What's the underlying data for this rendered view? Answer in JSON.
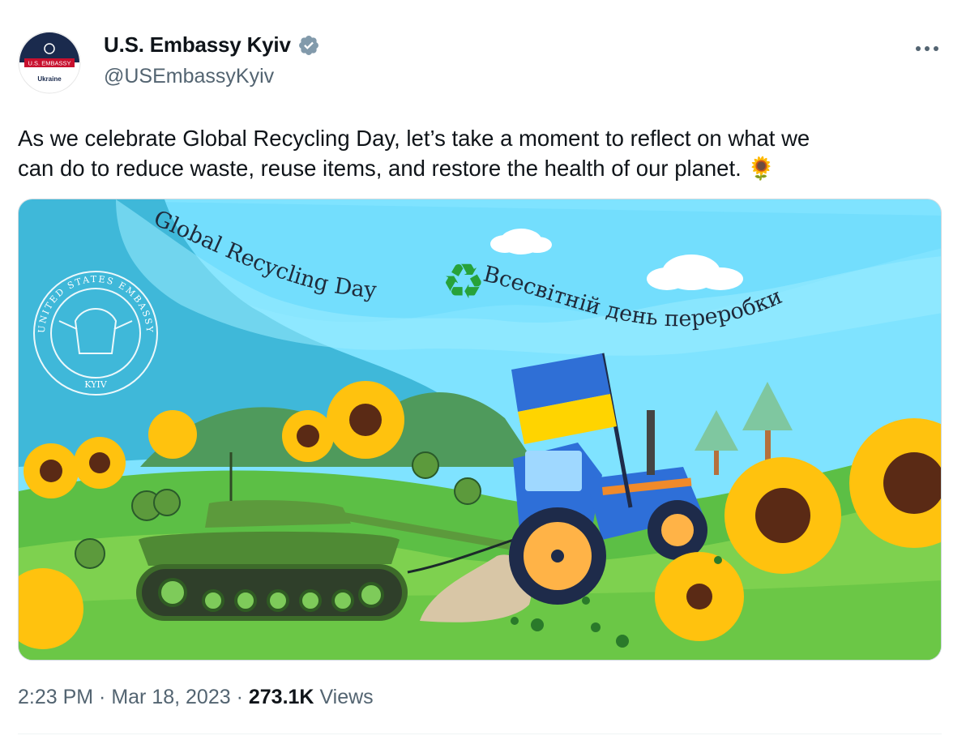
{
  "account": {
    "display_name": "U.S. Embassy Kyiv",
    "handle": "@USEmbassyKyiv",
    "avatar_banner": "U.S. EMBASSY",
    "avatar_caption": "Ukraine",
    "verified": true
  },
  "tweet": {
    "text_line1": "As we celebrate Global Recycling Day, let’s take a moment to reflect on what we",
    "text_line2": "can do to reduce waste, reuse items, and restore the health of our planet.",
    "emoji": "🌻"
  },
  "image": {
    "title_en": "Global Recycling Day",
    "title_uk": "Всесвітній день переробки",
    "seal_top": "UNITED STATES EMBASSY",
    "seal_bottom": "KYIV",
    "recycle_icon": "♻"
  },
  "meta": {
    "time": "2:23 PM",
    "separator": " · ",
    "date": "Mar 18, 2023",
    "views_count": "273.1K",
    "views_label": " Views"
  },
  "colors": {
    "sky": "#7fe3ff",
    "hills": "#6fc14b",
    "flag_blue": "#2f6fd6",
    "flag_yellow": "#ffd400",
    "tractor": "#2e6fd8",
    "tank": "#5c9a3c"
  }
}
